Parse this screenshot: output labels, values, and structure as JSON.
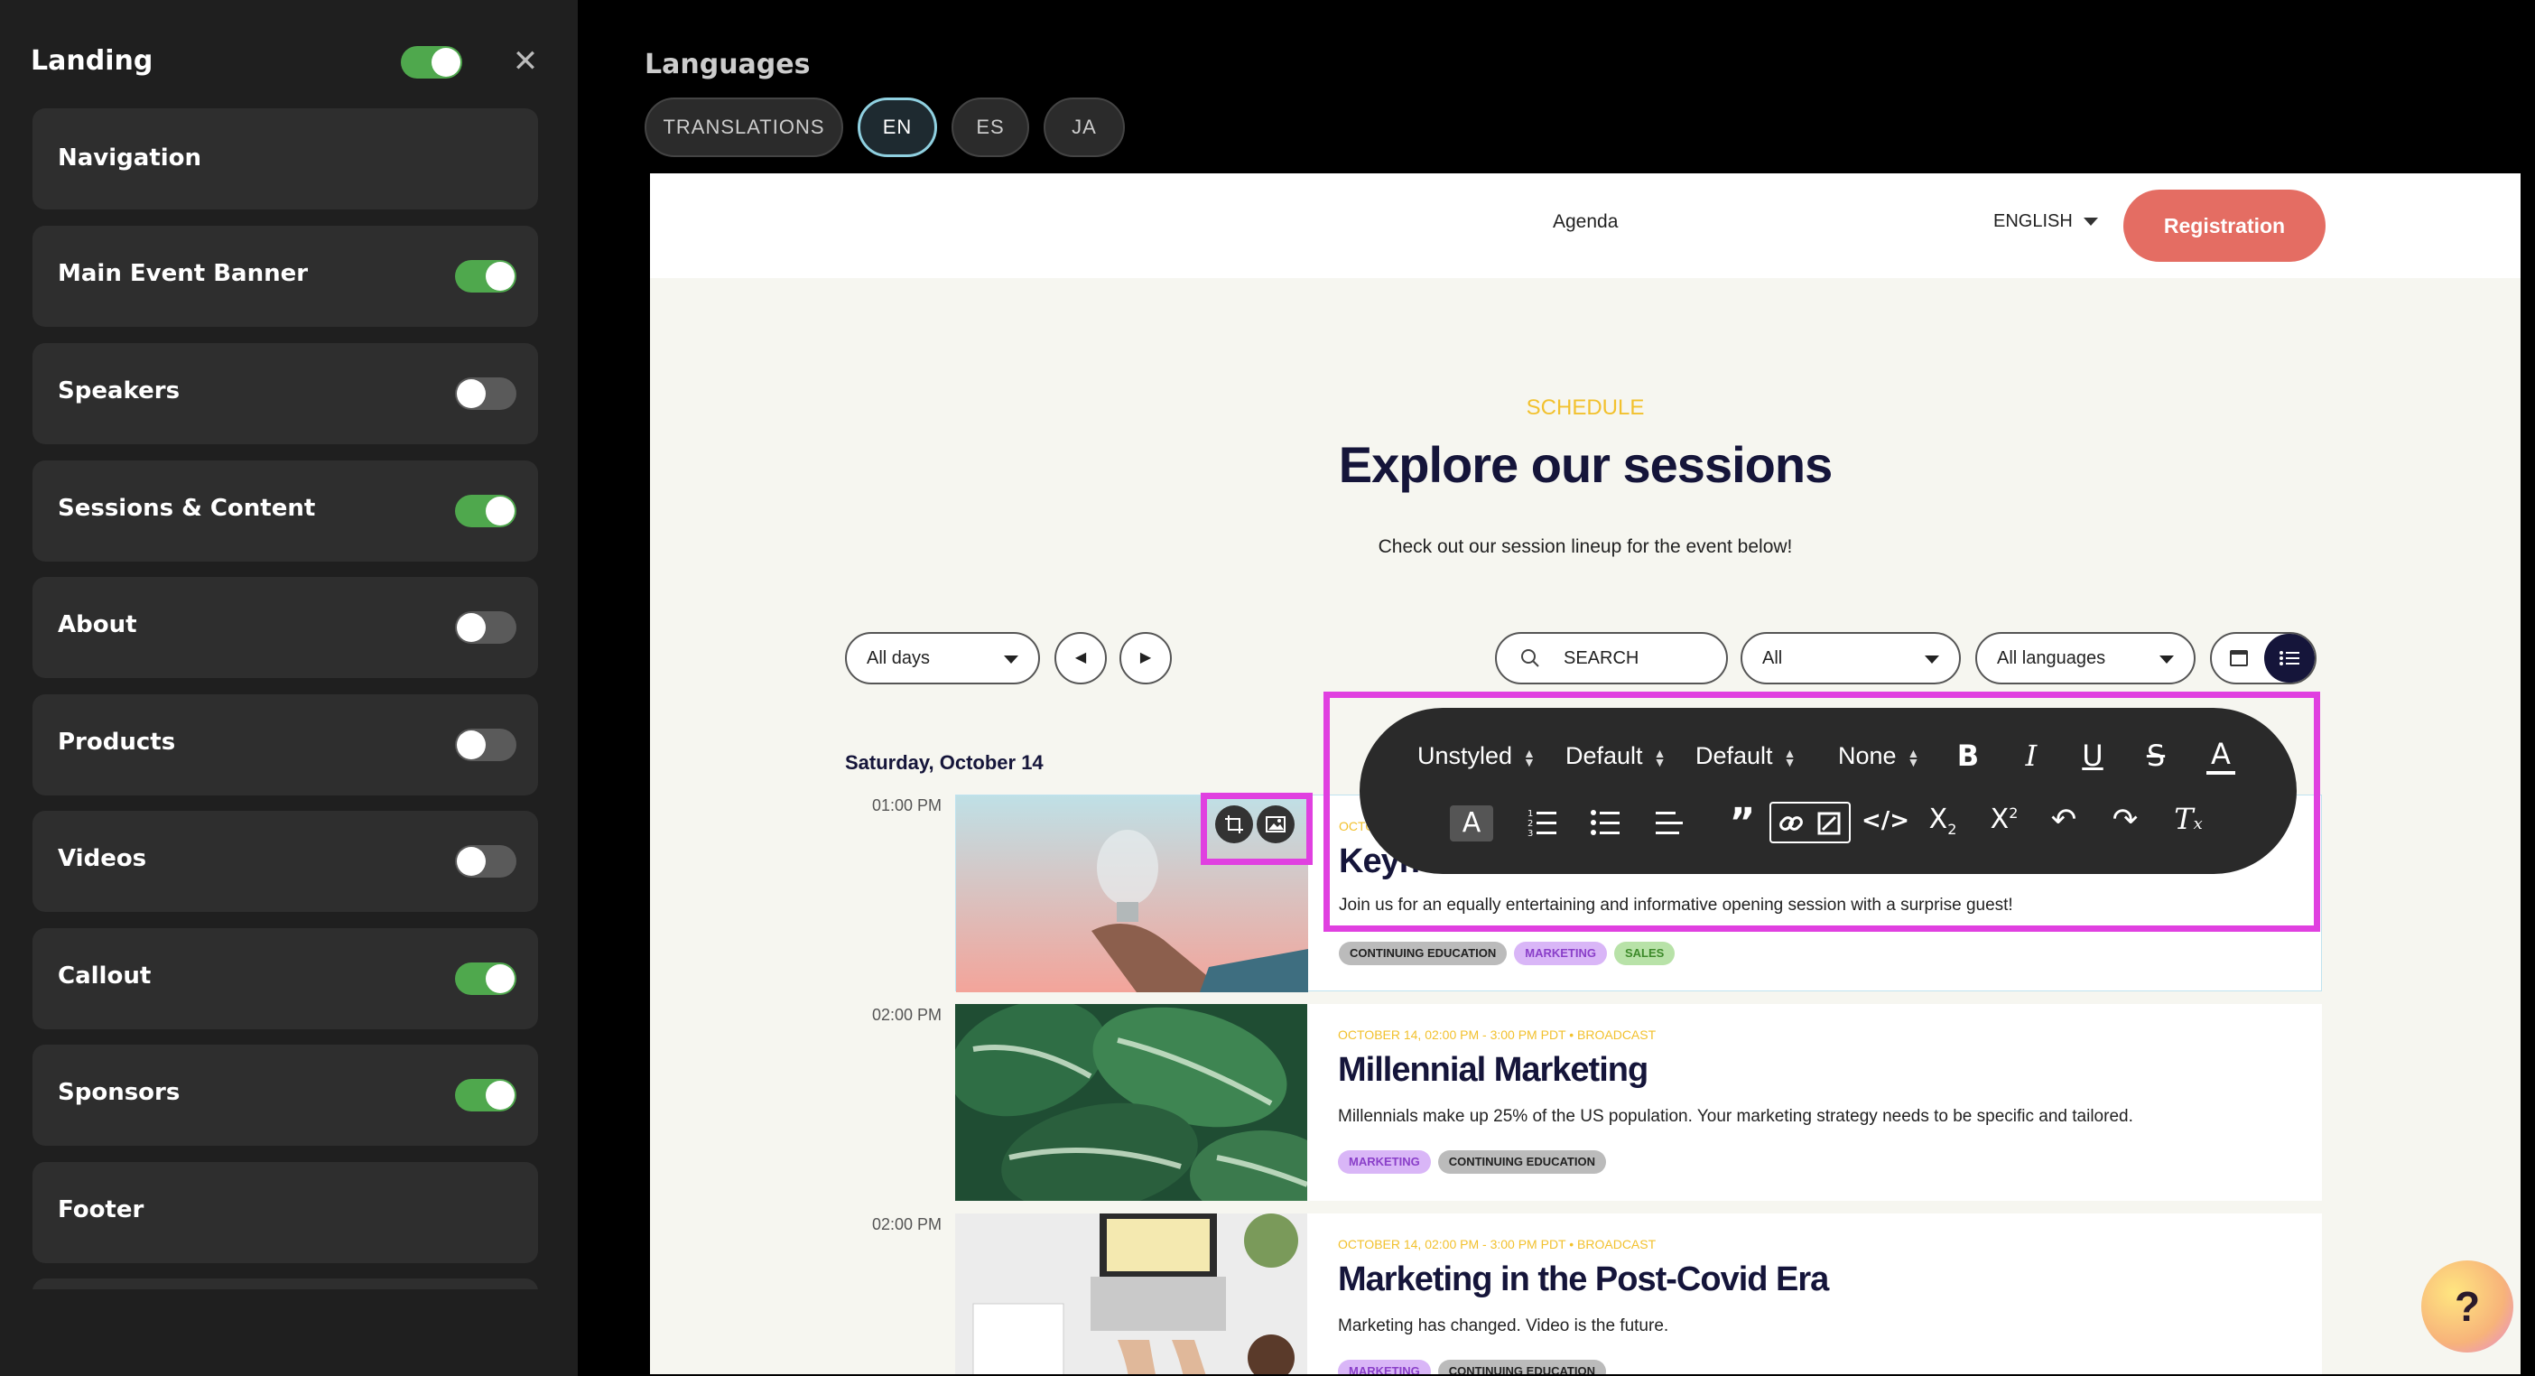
{
  "sidebar": {
    "title": "Landing",
    "master_toggle_on": true,
    "items": [
      {
        "label": "Navigation",
        "has_toggle": false,
        "on": false
      },
      {
        "label": "Main Event Banner",
        "has_toggle": true,
        "on": true
      },
      {
        "label": "Speakers",
        "has_toggle": true,
        "on": false
      },
      {
        "label": "Sessions & Content",
        "has_toggle": true,
        "on": true
      },
      {
        "label": "About",
        "has_toggle": true,
        "on": false
      },
      {
        "label": "Products",
        "has_toggle": true,
        "on": false
      },
      {
        "label": "Videos",
        "has_toggle": true,
        "on": false
      },
      {
        "label": "Callout",
        "has_toggle": true,
        "on": true
      },
      {
        "label": "Sponsors",
        "has_toggle": true,
        "on": true
      },
      {
        "label": "Footer",
        "has_toggle": false,
        "on": false
      }
    ]
  },
  "languages": {
    "title": "Languages",
    "tabs": [
      "TRANSLATIONS",
      "EN",
      "ES",
      "JA"
    ],
    "active": "EN"
  },
  "preview": {
    "nav": {
      "agenda": "Agenda",
      "language": "ENGLISH",
      "register": "Registration"
    },
    "schedule": {
      "kicker": "SCHEDULE",
      "title": "Explore our sessions",
      "subtitle": "Check out our session lineup for the event below!"
    },
    "filters": {
      "days": "All days",
      "search_placeholder": "SEARCH",
      "category": "All",
      "language": "All languages"
    },
    "date_heading": "Saturday, October 14",
    "sessions": [
      {
        "time": "01:00 PM",
        "meta": "OCTO",
        "title": "Keyn",
        "desc": "Join us for an equally entertaining and informative opening session with a surprise guest!",
        "tags": [
          "CONTINUING EDUCATION",
          "MARKETING",
          "SALES"
        ]
      },
      {
        "time": "02:00 PM",
        "meta": "OCTOBER 14, 02:00 PM - 3:00 PM PDT • BROADCAST",
        "title": "Millennial Marketing",
        "desc": "Millennials make up 25% of the US population. Your marketing strategy needs to be specific and tailored.",
        "tags": [
          "MARKETING",
          "CONTINUING EDUCATION"
        ]
      },
      {
        "time": "02:00 PM",
        "meta": "OCTOBER 14, 02:00 PM - 3:00 PM PDT • BROADCAST",
        "title": "Marketing in the Post-Covid Era",
        "desc": "Marketing has changed. Video is the future.",
        "tags": [
          "MARKETING",
          "CONTINUING EDUCATION"
        ]
      }
    ]
  },
  "toolbar": {
    "block_style": "Unstyled",
    "font_family": "Default",
    "font_size": "Default",
    "line_height": "None",
    "icons": [
      "bold-icon",
      "italic-icon",
      "underline-icon",
      "strikethrough-icon",
      "font-color-icon",
      "highlight-icon",
      "ordered-list-icon",
      "unordered-list-icon",
      "align-icon",
      "blockquote-icon",
      "link-icon",
      "unlink-icon",
      "code-icon",
      "subscript-icon",
      "superscript-icon",
      "undo-icon",
      "redo-icon",
      "clear-format-icon"
    ]
  },
  "help": {
    "label": "?"
  },
  "colors": {
    "accent_pink": "#e040e0",
    "toggle_on": "#4fa84d",
    "register_btn": "#e46d63",
    "schedule_kicker": "#f2c12e",
    "title_navy": "#15153a"
  }
}
